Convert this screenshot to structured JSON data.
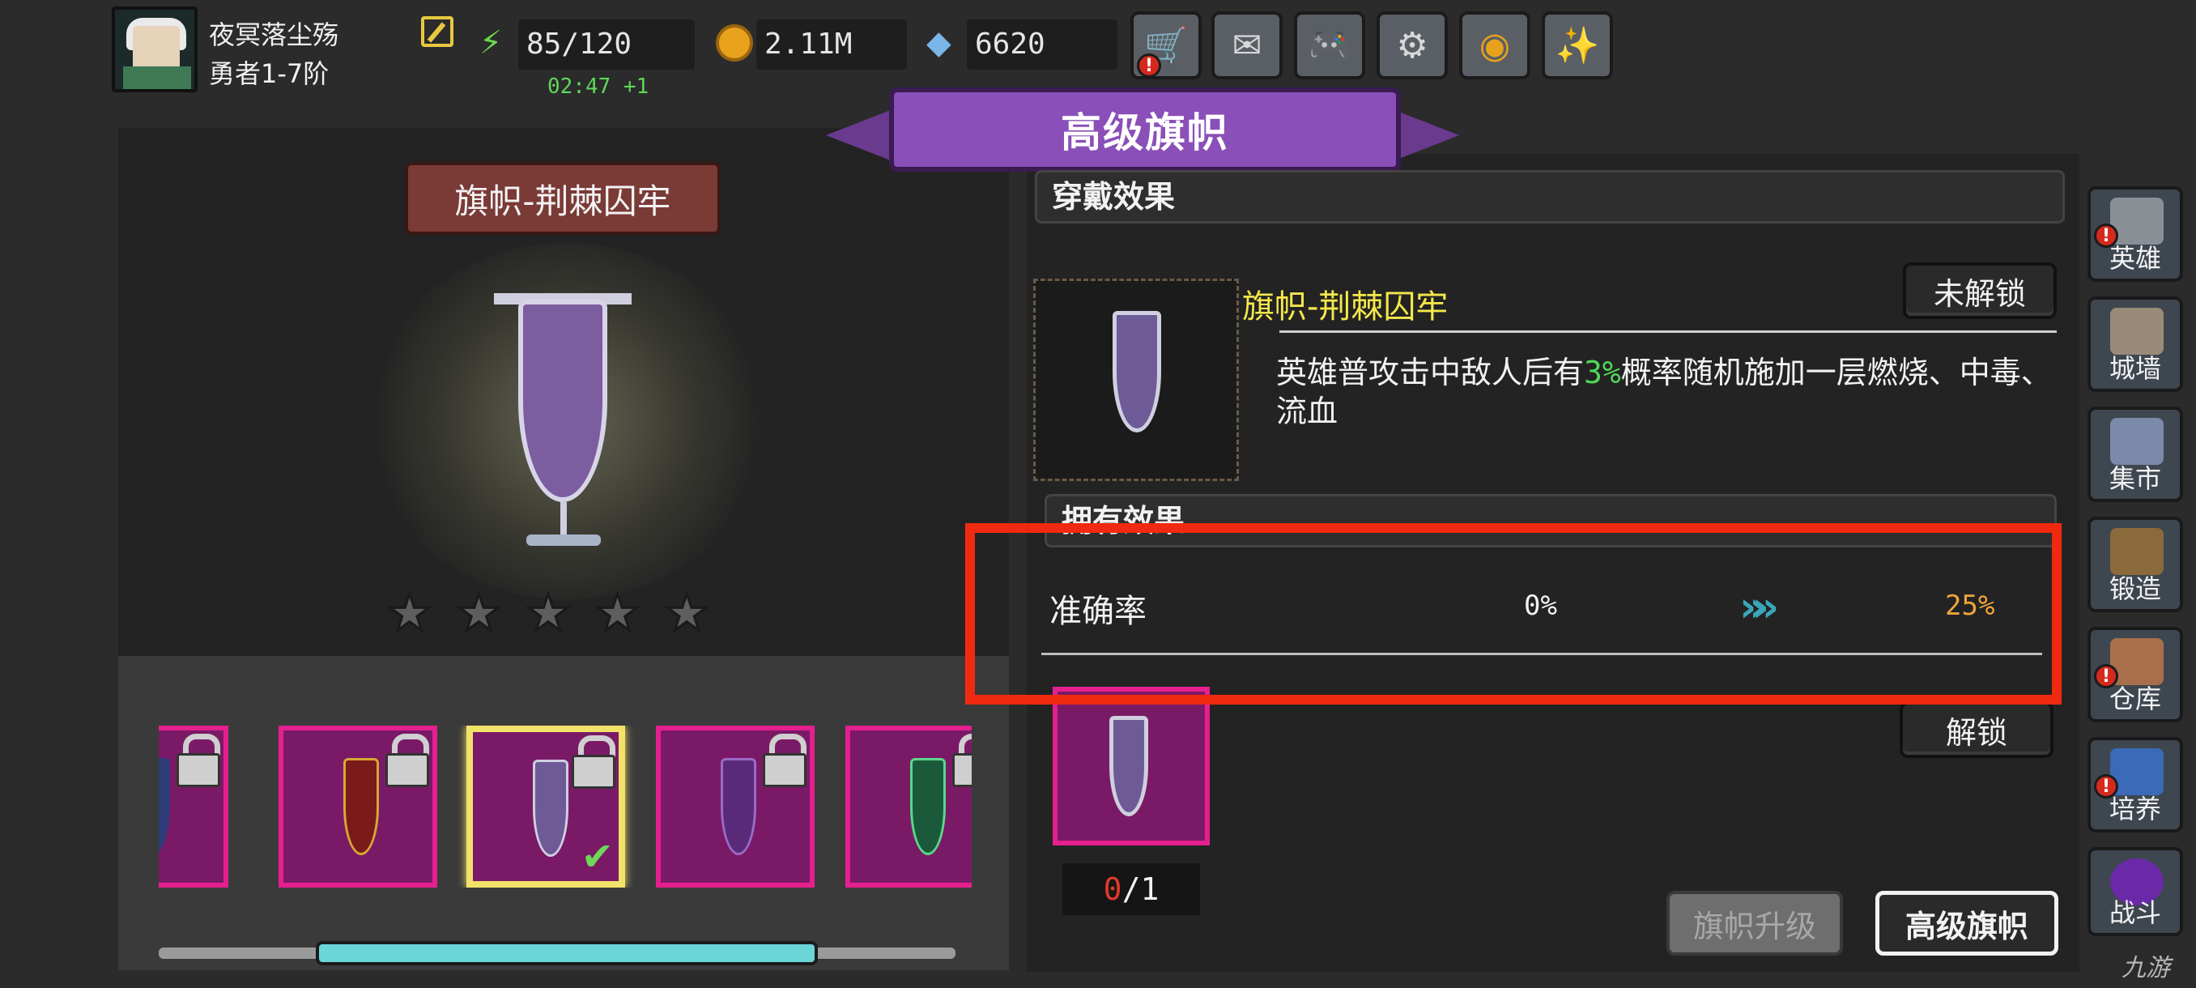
{
  "player": {
    "name": "夜冥落尘殇",
    "rank": "勇者1-7阶"
  },
  "resources": {
    "energy": "85/120",
    "energy_timer": "02:47 +1",
    "gold": "2.11M",
    "gems": "6620"
  },
  "top_buttons": [
    {
      "name": "shop",
      "icon": "cart-icon",
      "alert": "!"
    },
    {
      "name": "mail",
      "icon": "mail-icon"
    },
    {
      "name": "gamepad",
      "icon": "gamepad-icon"
    },
    {
      "name": "settings",
      "icon": "gear-icon"
    },
    {
      "name": "lottery",
      "icon": "wheel-icon"
    },
    {
      "name": "events",
      "icon": "firework-icon"
    }
  ],
  "header": {
    "title": "高级旗帜"
  },
  "left": {
    "banner_name": "旗帜-荆棘囚牢",
    "stars": 5,
    "stars_filled": 0
  },
  "wear_effect": {
    "section_title": "穿戴效果",
    "item_name": "旗帜-荆棘囚牢",
    "status_button": "未解锁",
    "desc_before": "英雄普攻击中敌人后有",
    "desc_pct": "3%",
    "desc_after": "概率随机施加一层燃烧、中毒、流血"
  },
  "own_effect": {
    "section_title": "拥有效果",
    "stat_label": "准确率",
    "stat_from": "0%",
    "stat_to": "25%"
  },
  "material": {
    "have": "0",
    "need": "/1",
    "unlock_button": "解锁"
  },
  "bottom_buttons": {
    "upgrade": "旗帜升级",
    "advanced": "高级旗帜"
  },
  "side_nav": [
    {
      "label": "英雄",
      "alert": "!"
    },
    {
      "label": "城墙"
    },
    {
      "label": "集市"
    },
    {
      "label": "锻造"
    },
    {
      "label": "仓库",
      "alert": "!"
    },
    {
      "label": "培养",
      "alert": "!"
    },
    {
      "label": "战斗"
    }
  ],
  "watermark": "九游",
  "colors": {
    "accent_purple": "#8a4fb8",
    "item_frame": "#e51f8e",
    "selected": "#f2e26a",
    "highlight": "#f02a10",
    "gain": "#f0a33a",
    "positive": "#4fd85a"
  }
}
